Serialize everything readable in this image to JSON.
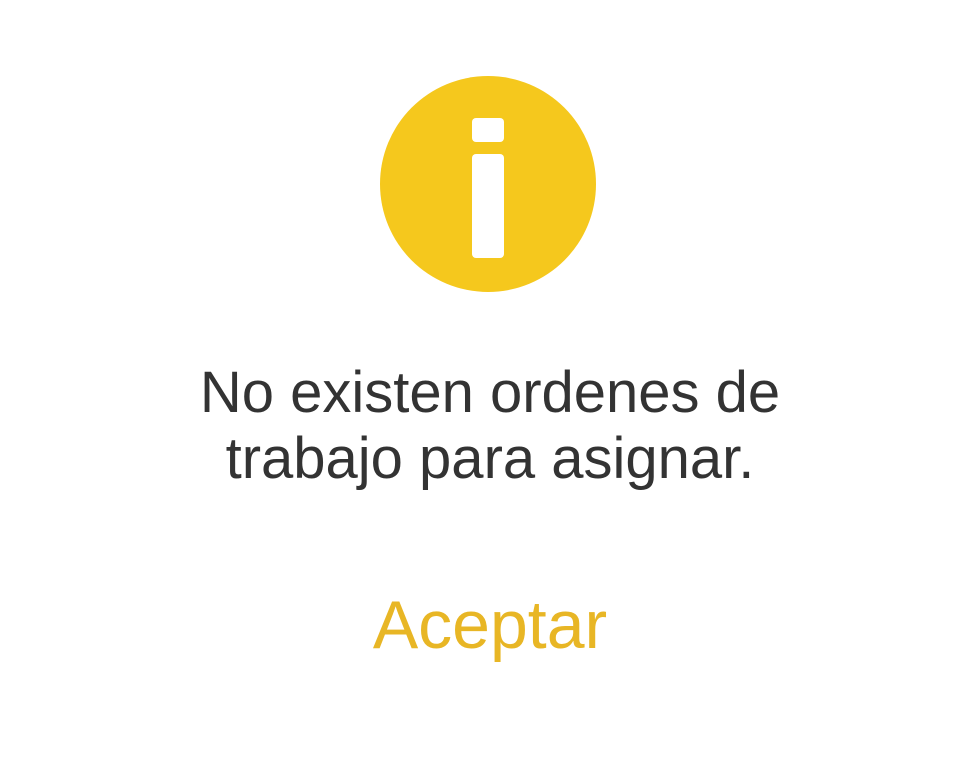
{
  "dialog": {
    "icon": "info-icon",
    "icon_color": "#F5C81D",
    "message_lines": [
      "No existen ordenes de",
      "trabajo para asignar."
    ],
    "accept_label": "Aceptar",
    "accept_color": "#E8B625",
    "text_color": "#333333"
  }
}
